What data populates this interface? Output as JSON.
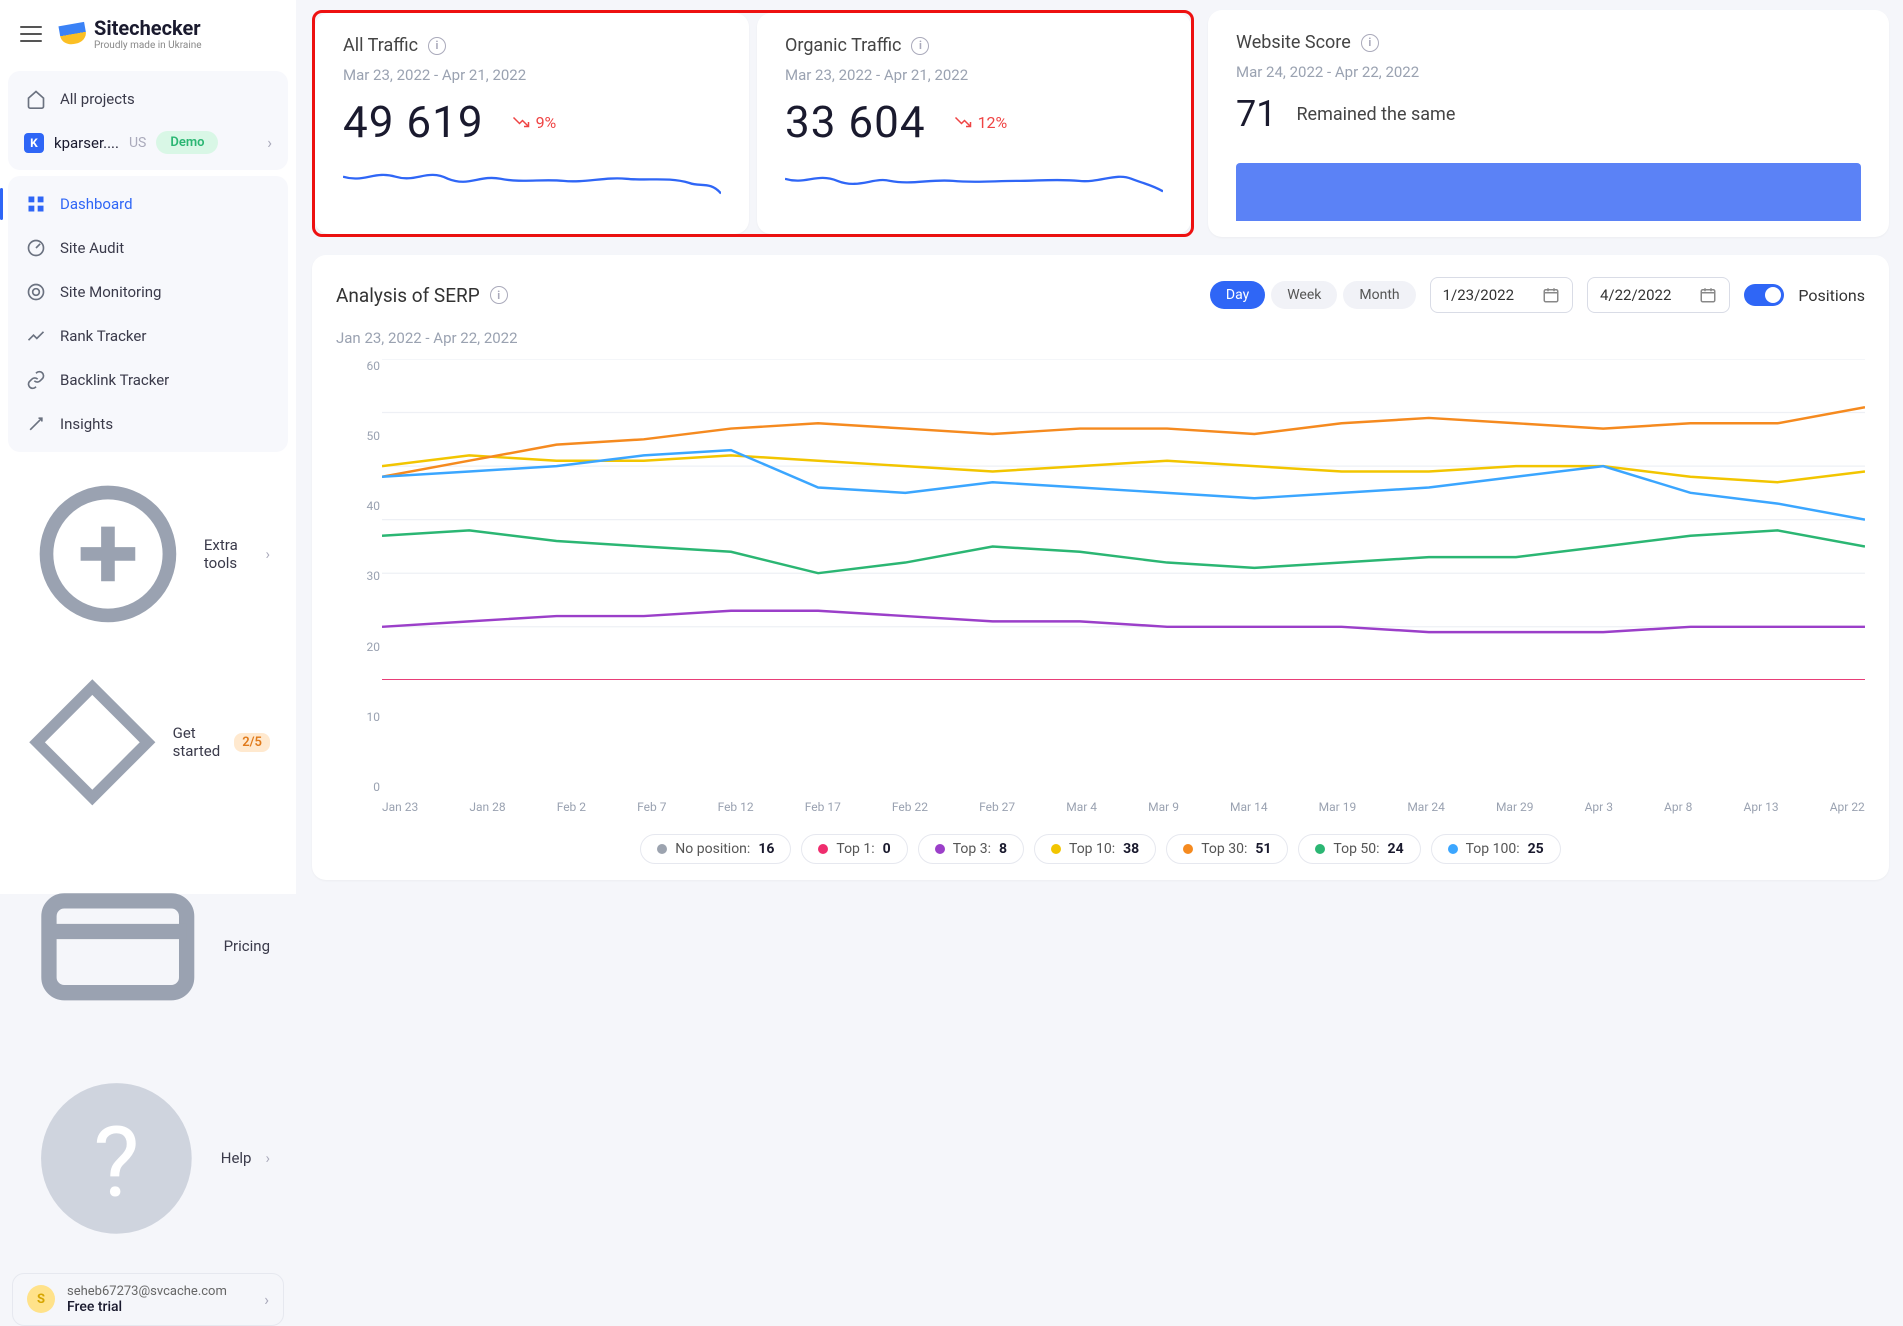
{
  "logo": {
    "name": "Sitechecker",
    "tagline": "Proudly made in Ukraine"
  },
  "sidebar": {
    "all_projects": "All projects",
    "project": {
      "name": "kparser....",
      "locale": "US",
      "demo": "Demo"
    },
    "nav": [
      {
        "label": "Dashboard"
      },
      {
        "label": "Site Audit"
      },
      {
        "label": "Site Monitoring"
      },
      {
        "label": "Rank Tracker"
      },
      {
        "label": "Backlink Tracker"
      },
      {
        "label": "Insights"
      }
    ],
    "extra_tools": "Extra tools",
    "get_started": {
      "label": "Get started",
      "progress": "2/5"
    },
    "pricing": "Pricing",
    "help": "Help",
    "user": {
      "initial": "S",
      "email": "seheb67273@svcache.com",
      "plan": "Free trial"
    }
  },
  "metrics": {
    "all_traffic": {
      "title": "All Traffic",
      "range": "Mar 23, 2022 - Apr 21, 2022",
      "value": "49 619",
      "delta": "9%"
    },
    "organic": {
      "title": "Organic Traffic",
      "range": "Mar 23, 2022 - Apr 21, 2022",
      "value": "33 604",
      "delta": "12%"
    },
    "score": {
      "title": "Website Score",
      "range": "Mar 24, 2022 - Apr 22, 2022",
      "value": "71",
      "status": "Remained the same"
    }
  },
  "serp": {
    "title": "Analysis of SERP",
    "range": "Jan 23, 2022 - Apr 22, 2022",
    "segments": {
      "day": "Day",
      "week": "Week",
      "month": "Month"
    },
    "date_from": "1/23/2022",
    "date_to": "4/22/2022",
    "toggle_label": "Positions",
    "y_ticks": [
      "60",
      "50",
      "40",
      "30",
      "20",
      "10",
      "0"
    ],
    "x_ticks": [
      "Jan 23",
      "Jan 28",
      "Feb 2",
      "Feb 7",
      "Feb 12",
      "Feb 17",
      "Feb 22",
      "Feb 27",
      "Mar 4",
      "Mar 9",
      "Mar 14",
      "Mar 19",
      "Mar 24",
      "Mar 29",
      "Apr 3",
      "Apr 8",
      "Apr 13",
      "Apr 22"
    ],
    "legend": [
      {
        "label": "No position:",
        "value": "16",
        "color": "#9ca3af"
      },
      {
        "label": "Top 1:",
        "value": "0",
        "color": "#ef2d6e"
      },
      {
        "label": "Top 3:",
        "value": "8",
        "color": "#9b3fc9"
      },
      {
        "label": "Top 10:",
        "value": "38",
        "color": "#f2c500"
      },
      {
        "label": "Top 30:",
        "value": "51",
        "color": "#f58a1f"
      },
      {
        "label": "Top 50:",
        "value": "24",
        "color": "#2bb673"
      },
      {
        "label": "Top 100:",
        "value": "25",
        "color": "#3ba6ff"
      }
    ]
  },
  "chart_data": {
    "type": "line",
    "title": "Analysis of SERP",
    "xlabel": "",
    "ylabel": "",
    "ylim": [
      0,
      60
    ],
    "categories": [
      "Jan 23",
      "Jan 28",
      "Feb 2",
      "Feb 7",
      "Feb 12",
      "Feb 17",
      "Feb 22",
      "Feb 27",
      "Mar 4",
      "Mar 9",
      "Mar 14",
      "Mar 19",
      "Mar 24",
      "Mar 29",
      "Apr 3",
      "Apr 8",
      "Apr 13",
      "Apr 22"
    ],
    "series": [
      {
        "name": "No position",
        "color": "#9ca3af",
        "values": [
          0,
          0,
          0,
          0,
          0,
          0,
          0,
          0,
          0,
          0,
          0,
          0,
          0,
          0,
          0,
          0,
          0,
          0
        ]
      },
      {
        "name": "Top 1",
        "color": "#ef2d6e",
        "values": [
          0,
          0,
          0,
          0,
          0,
          0,
          0,
          0,
          0,
          0,
          0,
          0,
          0,
          0,
          0,
          0,
          0,
          0
        ]
      },
      {
        "name": "Top 3",
        "color": "#9b3fc9",
        "values": [
          10,
          11,
          12,
          12,
          13,
          13,
          12,
          11,
          11,
          10,
          10,
          10,
          9,
          9,
          9,
          10,
          10,
          10
        ]
      },
      {
        "name": "Top 10",
        "color": "#f2c500",
        "values": [
          40,
          42,
          41,
          41,
          42,
          41,
          40,
          39,
          40,
          41,
          40,
          39,
          39,
          40,
          40,
          38,
          37,
          39
        ]
      },
      {
        "name": "Top 30",
        "color": "#f58a1f",
        "values": [
          38,
          41,
          44,
          45,
          47,
          48,
          47,
          46,
          47,
          47,
          46,
          48,
          49,
          48,
          47,
          48,
          48,
          51
        ]
      },
      {
        "name": "Top 50",
        "color": "#2bb673",
        "values": [
          27,
          28,
          26,
          25,
          24,
          20,
          22,
          25,
          24,
          22,
          21,
          22,
          23,
          23,
          25,
          27,
          28,
          25
        ]
      },
      {
        "name": "Top 100",
        "color": "#3ba6ff",
        "values": [
          38,
          39,
          40,
          42,
          43,
          36,
          35,
          37,
          36,
          35,
          34,
          35,
          36,
          38,
          40,
          35,
          33,
          30
        ]
      }
    ]
  }
}
